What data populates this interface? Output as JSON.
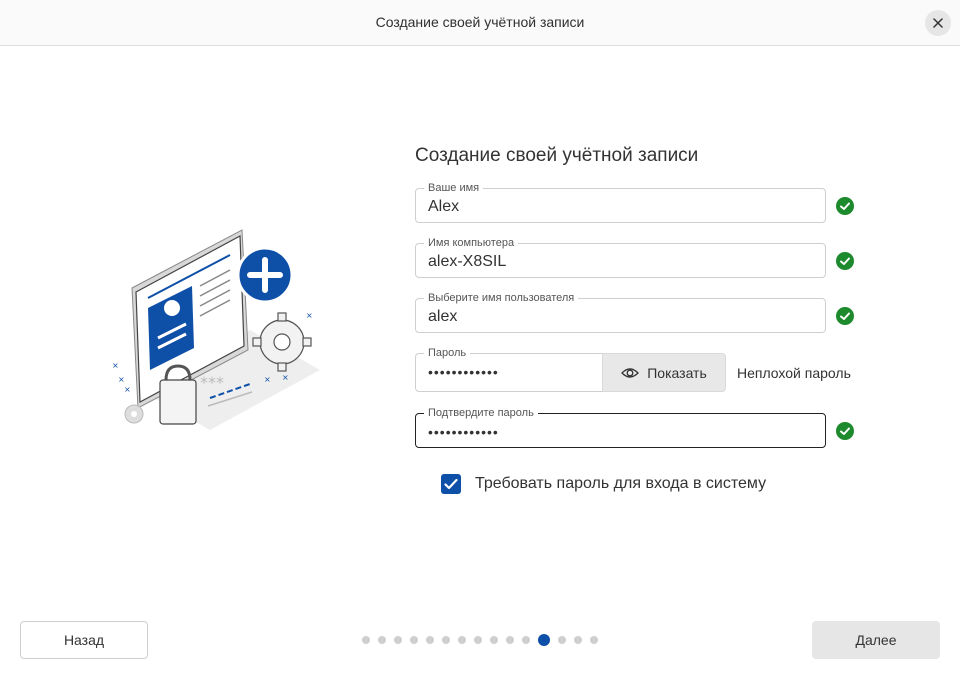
{
  "window": {
    "title": "Создание своей учётной записи"
  },
  "main": {
    "heading": "Создание своей учётной записи",
    "fields": {
      "name": {
        "label": "Ваше имя",
        "value": "Alex"
      },
      "computer": {
        "label": "Имя компьютера",
        "value": "alex-X8SIL"
      },
      "username": {
        "label": "Выберите имя пользователя",
        "value": "alex"
      },
      "password": {
        "label": "Пароль",
        "value": "••••••••••••"
      },
      "confirm": {
        "label": "Подтвердите пароль",
        "value": "••••••••••••"
      }
    },
    "show_button": "Показать",
    "strength": "Неплохой пароль",
    "require_password": {
      "label": "Требовать пароль для входа в систему",
      "checked": true
    }
  },
  "footer": {
    "back": "Назад",
    "next": "Далее",
    "steps_total": 15,
    "steps_current": 12
  },
  "colors": {
    "accent": "#0e4fa8",
    "valid": "#1e8a2e"
  }
}
